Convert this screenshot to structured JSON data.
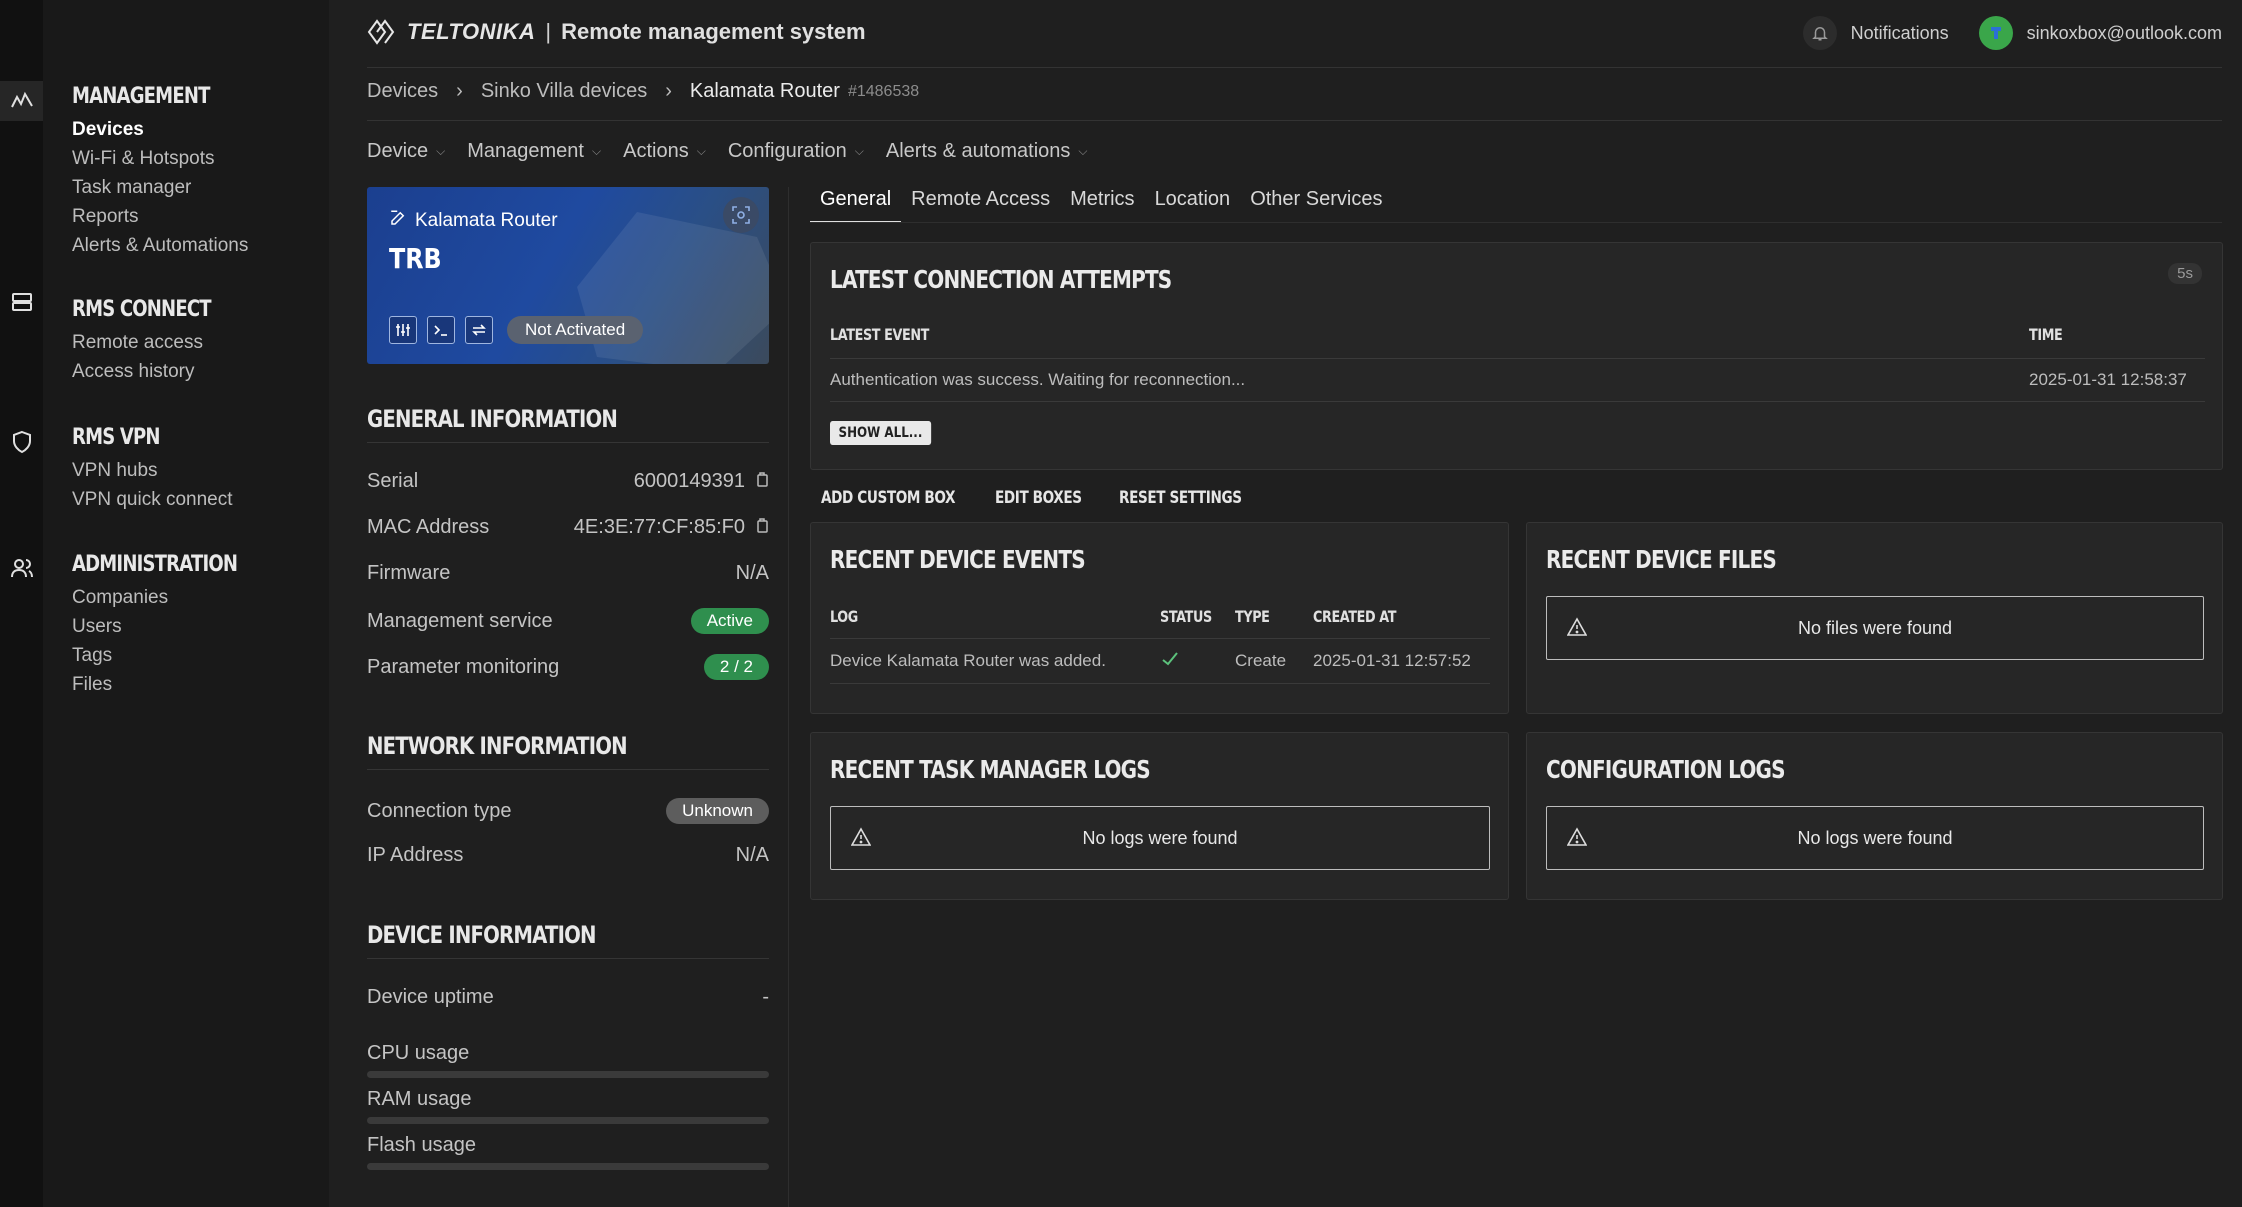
{
  "app": {
    "brand": "TELTONIKA",
    "separator": "|",
    "title": "Remote management system",
    "notifications_label": "Notifications",
    "user_email": "sinkoxbox@outlook.com"
  },
  "sidebar": {
    "sections": [
      {
        "title": "MANAGEMENT",
        "items": [
          "Devices",
          "Wi-Fi & Hotspots",
          "Task manager",
          "Reports",
          "Alerts & Automations"
        ]
      },
      {
        "title": "RMS CONNECT",
        "items": [
          "Remote access",
          "Access history"
        ]
      },
      {
        "title": "RMS VPN",
        "items": [
          "VPN hubs",
          "VPN quick connect"
        ]
      },
      {
        "title": "ADMINISTRATION",
        "items": [
          "Companies",
          "Users",
          "Tags",
          "Files"
        ]
      }
    ],
    "active_item": "Devices"
  },
  "breadcrumb": {
    "items": [
      "Devices",
      "Sinko Villa devices",
      "Kalamata Router"
    ],
    "device_id": "#1486538"
  },
  "menubar": {
    "items": [
      "Device",
      "Management",
      "Actions",
      "Configuration",
      "Alerts & automations"
    ]
  },
  "device_card": {
    "name": "Kalamata Router",
    "model": "TRB",
    "status": "Not Activated"
  },
  "general_info": {
    "title": "GENERAL INFORMATION",
    "serial_label": "Serial",
    "serial": "6000149391",
    "mac_label": "MAC Address",
    "mac": "4E:3E:77:CF:85:F0",
    "firmware_label": "Firmware",
    "firmware": "N/A",
    "mgmt_label": "Management service",
    "mgmt": "Active",
    "param_label": "Parameter monitoring",
    "param": "2 / 2"
  },
  "network_info": {
    "title": "NETWORK INFORMATION",
    "conn_label": "Connection type",
    "conn": "Unknown",
    "ip_label": "IP Address",
    "ip": "N/A"
  },
  "device_info": {
    "title": "DEVICE INFORMATION",
    "uptime_label": "Device uptime",
    "uptime": "-",
    "cpu_label": "CPU usage",
    "ram_label": "RAM usage",
    "flash_label": "Flash usage"
  },
  "tabs": [
    "General",
    "Remote Access",
    "Metrics",
    "Location",
    "Other Services"
  ],
  "connection_attempts": {
    "title": "LATEST CONNECTION ATTEMPTS",
    "refresh": "5s",
    "col_event": "LATEST EVENT",
    "col_time": "TIME",
    "event": "Authentication was success. Waiting for reconnection...",
    "time": "2025-01-31 12:58:37",
    "show_all": "SHOW ALL..."
  },
  "box_actions": [
    "ADD CUSTOM BOX",
    "EDIT BOXES",
    "RESET SETTINGS"
  ],
  "device_events": {
    "title": "RECENT DEVICE EVENTS",
    "col_log": "LOG",
    "col_status": "STATUS",
    "col_type": "TYPE",
    "col_created": "CREATED AT",
    "log": "Device Kalamata Router was added.",
    "type": "Create",
    "created": "2025-01-31 12:57:52"
  },
  "device_files": {
    "title": "RECENT DEVICE FILES",
    "empty": "No files were found"
  },
  "task_logs": {
    "title": "RECENT TASK MANAGER LOGS",
    "empty": "No logs were found"
  },
  "config_logs": {
    "title": "CONFIGURATION LOGS",
    "empty": "No logs were found"
  },
  "colors": {
    "accent_green": "#2f8f4e",
    "card_blue": "#1f4aa0",
    "background": "#1f1f1f"
  }
}
